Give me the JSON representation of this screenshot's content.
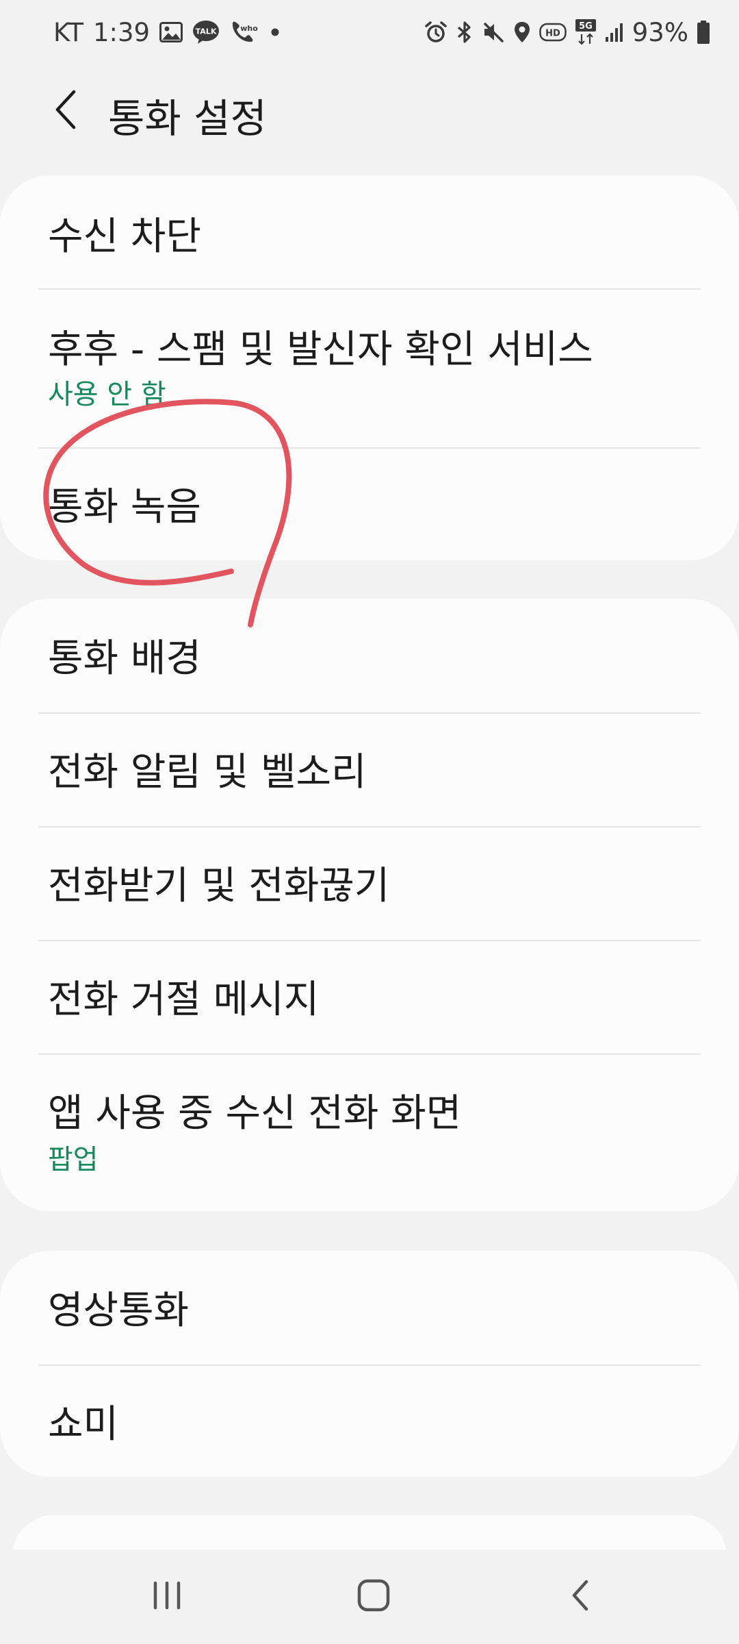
{
  "status_bar": {
    "carrier": "KT",
    "time": "1:39",
    "talk_label": "TALK",
    "whowho_label": "who",
    "hd_label": "HD",
    "network_label": "5G",
    "battery": "93%"
  },
  "header": {
    "title": "통화 설정"
  },
  "groups": [
    {
      "items": [
        {
          "title": "수신 차단",
          "subtitle": ""
        },
        {
          "title": "후후 - 스팸 및 발신자 확인 서비스",
          "subtitle": "사용 안 함"
        },
        {
          "title": "통화 녹음",
          "subtitle": ""
        }
      ]
    },
    {
      "items": [
        {
          "title": "통화 배경",
          "subtitle": ""
        },
        {
          "title": "전화 알림 및 벨소리",
          "subtitle": ""
        },
        {
          "title": "전화받기 및 전화끊기",
          "subtitle": ""
        },
        {
          "title": "전화 거절 메시지",
          "subtitle": ""
        },
        {
          "title": "앱 사용 중 수신 전화 화면",
          "subtitle": "팝업"
        }
      ]
    },
    {
      "items": [
        {
          "title": "영상통화",
          "subtitle": ""
        },
        {
          "title": "쇼미",
          "subtitle": ""
        }
      ]
    }
  ],
  "colors": {
    "background": "#f2f2f2",
    "card": "#fcfcfc",
    "subtitle_green": "#148a5a",
    "annotation_red": "#e2555f"
  }
}
